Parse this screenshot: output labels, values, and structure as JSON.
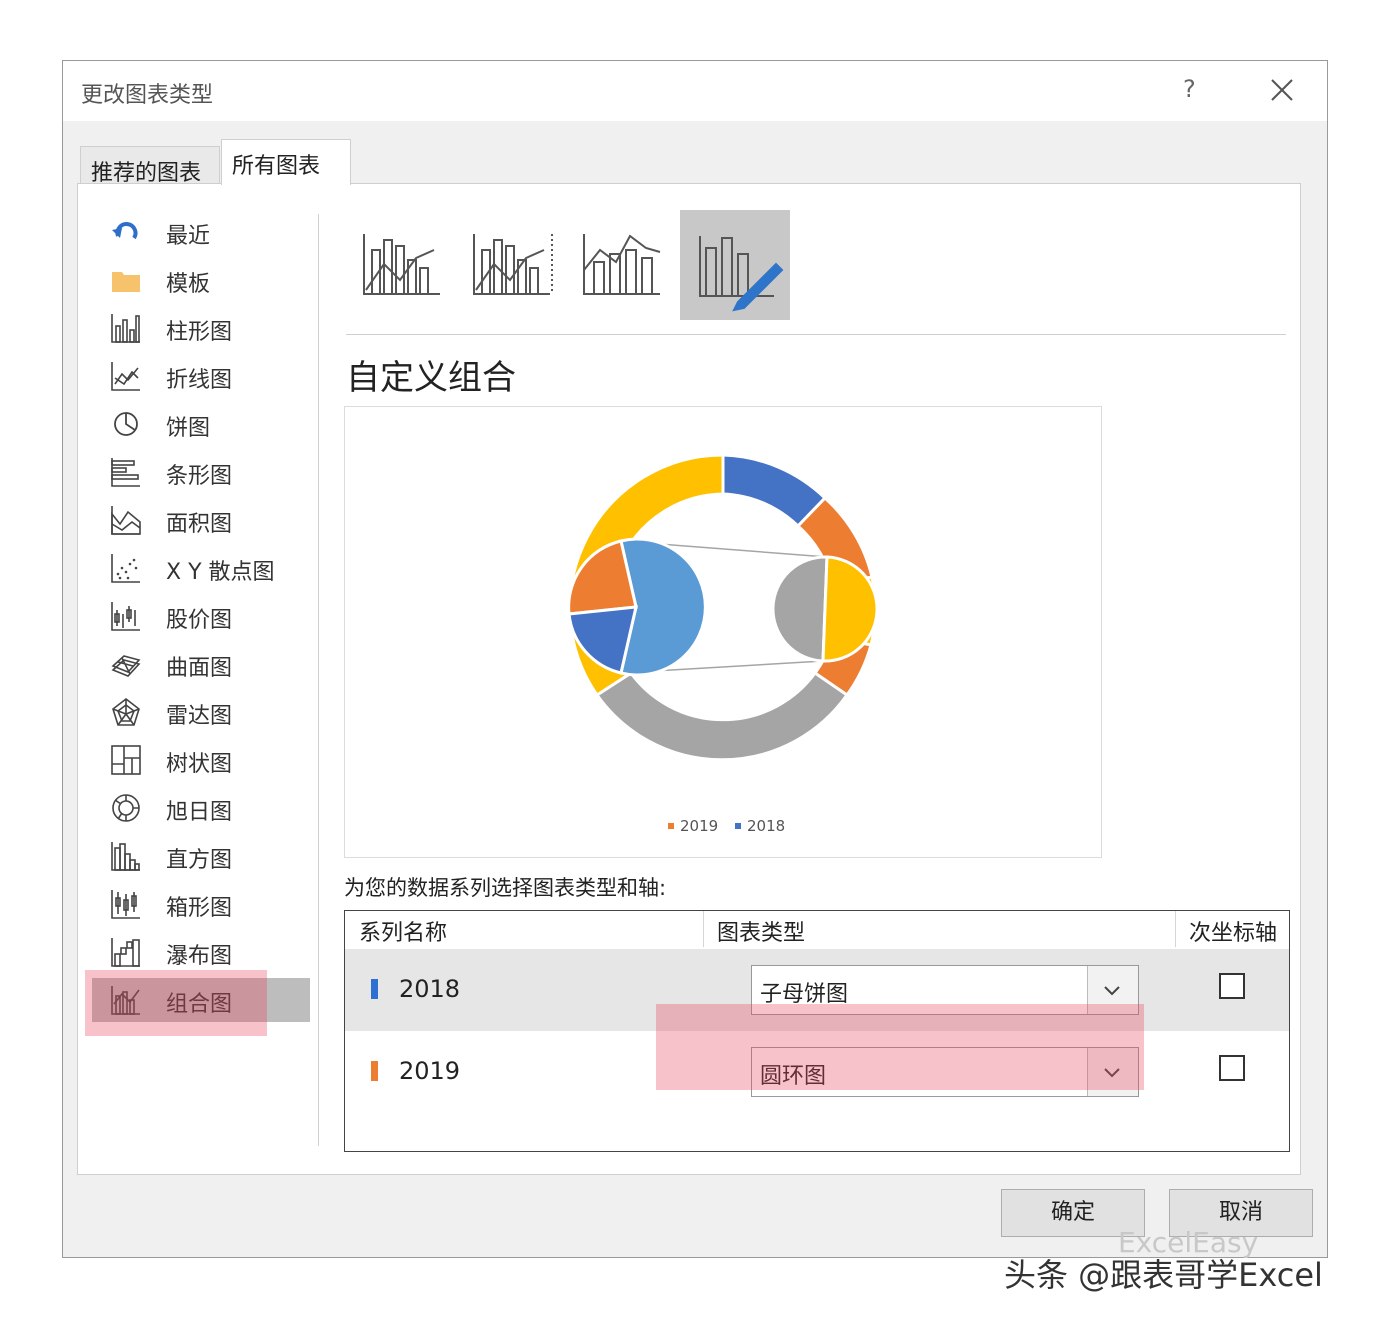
{
  "dialog": {
    "title": "更改图表类型",
    "help": "?",
    "tabs": [
      "推荐的图表",
      "所有图表"
    ],
    "sidebar": [
      {
        "label": "最近",
        "icon": "recent-arrow-icon"
      },
      {
        "label": "模板",
        "icon": "folder-icon"
      },
      {
        "label": "柱形图",
        "icon": "column-chart-icon"
      },
      {
        "label": "折线图",
        "icon": "line-chart-icon"
      },
      {
        "label": "饼图",
        "icon": "pie-chart-icon"
      },
      {
        "label": "条形图",
        "icon": "bar-chart-icon"
      },
      {
        "label": "面积图",
        "icon": "area-chart-icon"
      },
      {
        "label": "X Y 散点图",
        "icon": "scatter-chart-icon"
      },
      {
        "label": "股价图",
        "icon": "stock-chart-icon"
      },
      {
        "label": "曲面图",
        "icon": "surface-chart-icon"
      },
      {
        "label": "雷达图",
        "icon": "radar-chart-icon"
      },
      {
        "label": "树状图",
        "icon": "treemap-chart-icon"
      },
      {
        "label": "旭日图",
        "icon": "sunburst-chart-icon"
      },
      {
        "label": "直方图",
        "icon": "histogram-chart-icon"
      },
      {
        "label": "箱形图",
        "icon": "box-whisker-chart-icon"
      },
      {
        "label": "瀑布图",
        "icon": "waterfall-chart-icon"
      },
      {
        "label": "组合图",
        "icon": "combo-chart-icon"
      }
    ],
    "selected_sidebar": "组合图",
    "subtype_title": "自定义组合",
    "instruction": "为您的数据系列选择图表类型和轴:",
    "table": {
      "headers": [
        "系列名称",
        "图表类型",
        "次坐标轴"
      ],
      "rows": [
        {
          "series": "2018",
          "color": "#4472c4",
          "chart_type": "子母饼图",
          "secondary_axis": false
        },
        {
          "series": "2019",
          "color": "#ed7d31",
          "chart_type": "圆环图",
          "secondary_axis": false
        }
      ]
    },
    "ok": "确定",
    "cancel": "取消"
  },
  "preview": {
    "legend": [
      "2019",
      "2018"
    ],
    "colors": {
      "blue": "#4472c4",
      "orange": "#ed7d31",
      "gray": "#a5a5a5",
      "yellow": "#ffc000",
      "lightblue": "#5b9bd5"
    }
  },
  "watermark": {
    "text": "头条 @跟表哥学Excel",
    "faint": "ExcelEasy"
  }
}
